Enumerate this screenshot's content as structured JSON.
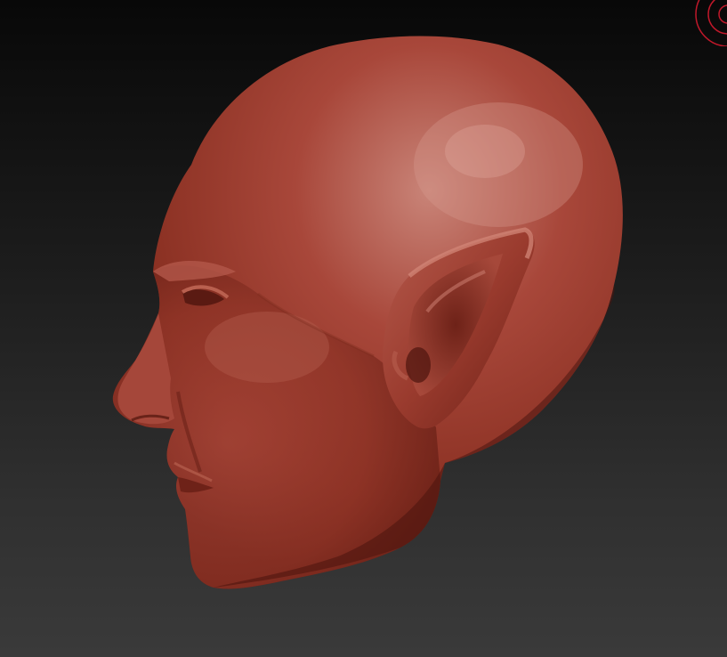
{
  "app": {
    "view": "3d-viewport",
    "background_colors": [
      "#080808",
      "#3a3a3a"
    ]
  },
  "model": {
    "subject": "sculpted-head-elf-ear",
    "material_color": "#9a3a2a",
    "highlight_color": "#c9766a",
    "shadow_color": "#4a1510"
  },
  "gizmo": {
    "icon": "rotation-gizmo-icon",
    "color": "#c0182a"
  }
}
